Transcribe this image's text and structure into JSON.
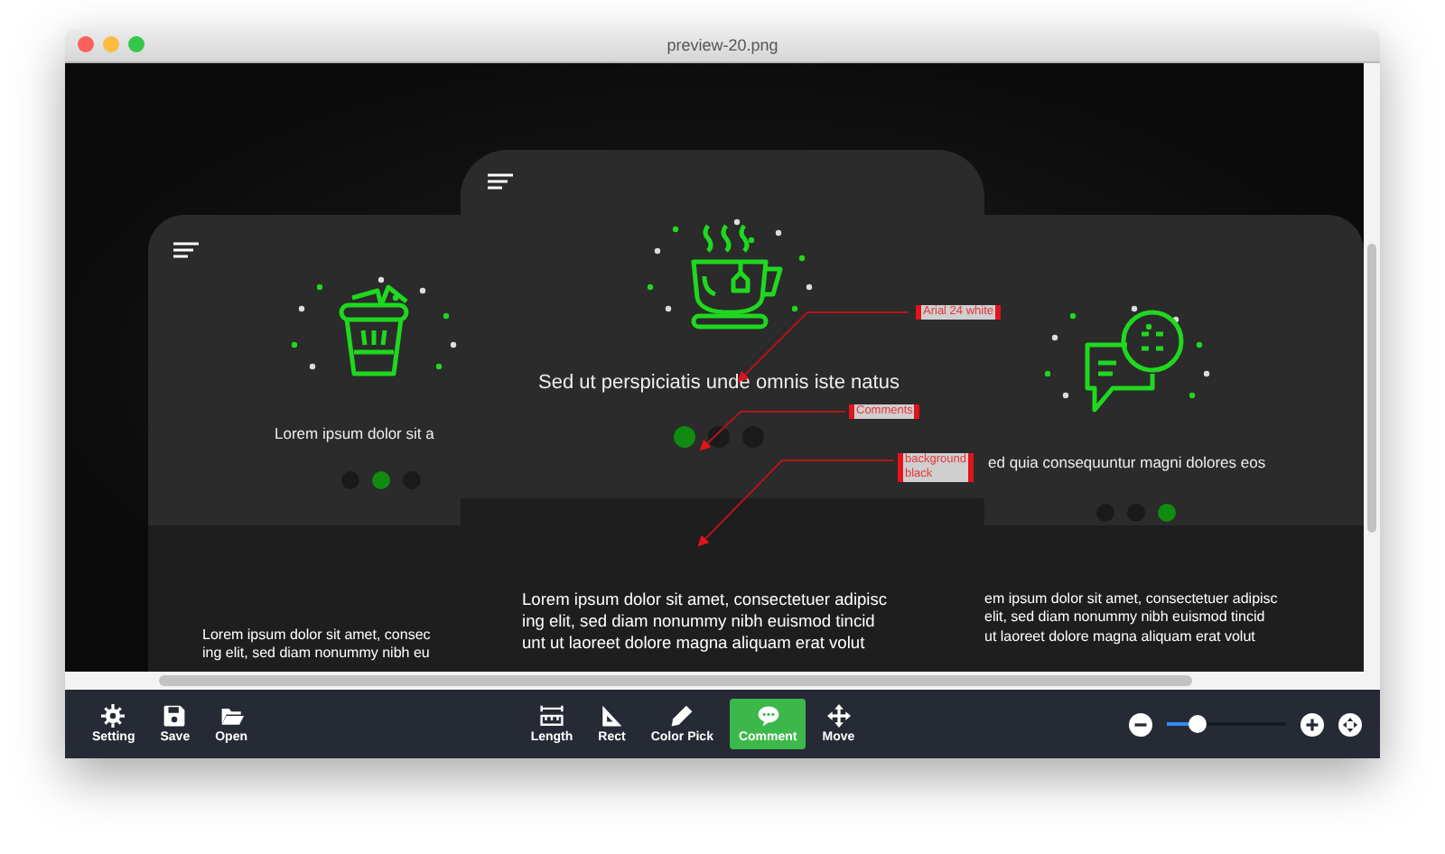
{
  "window": {
    "title": "preview-20.png"
  },
  "cards": [
    {
      "title": "Lorem ipsum dolor sit a",
      "dots": [
        {
          "selected": false
        },
        {
          "selected": true
        },
        {
          "selected": false
        }
      ],
      "body": [
        "Lorem ipsum dolor sit amet, consec",
        "ing elit, sed diam nonummy nibh eu"
      ]
    },
    {
      "title": "Sed ut perspiciatis unde omnis iste natus",
      "dots": [
        {
          "selected": true
        },
        {
          "selected": false
        },
        {
          "selected": false
        }
      ],
      "body": [
        "Lorem ipsum dolor sit amet, consectetuer adipisc",
        "ing elit, sed diam nonummy nibh euismod tincid",
        "unt ut laoreet dolore magna aliquam erat volut"
      ]
    },
    {
      "title": "ed quia consequuntur magni dolores eos",
      "dots": [
        {
          "selected": false
        },
        {
          "selected": false
        },
        {
          "selected": true
        }
      ],
      "body": [
        "em ipsum dolor sit amet, consectetuer adipisc",
        "elit, sed diam nonummy nibh euismod tincid",
        "ut laoreet dolore magna aliquam erat volut"
      ]
    }
  ],
  "annotations": [
    {
      "text": "Arial 24 white"
    },
    {
      "text": "Comments"
    },
    {
      "text": "background black"
    }
  ],
  "toolbar": {
    "left": [
      {
        "kind": "gear",
        "label": "Setting"
      },
      {
        "kind": "save",
        "label": "Save"
      },
      {
        "kind": "folder",
        "label": "Open"
      }
    ],
    "center": [
      {
        "kind": "ruler",
        "label": "Length",
        "selected": false
      },
      {
        "kind": "triangle",
        "label": "Rect",
        "selected": false
      },
      {
        "kind": "pencil",
        "label": "Color Pick",
        "selected": false
      },
      {
        "kind": "comment",
        "label": "Comment",
        "selected": true
      },
      {
        "kind": "move",
        "label": "Move",
        "selected": false
      }
    ],
    "zoom": {
      "level": 0.25
    }
  }
}
